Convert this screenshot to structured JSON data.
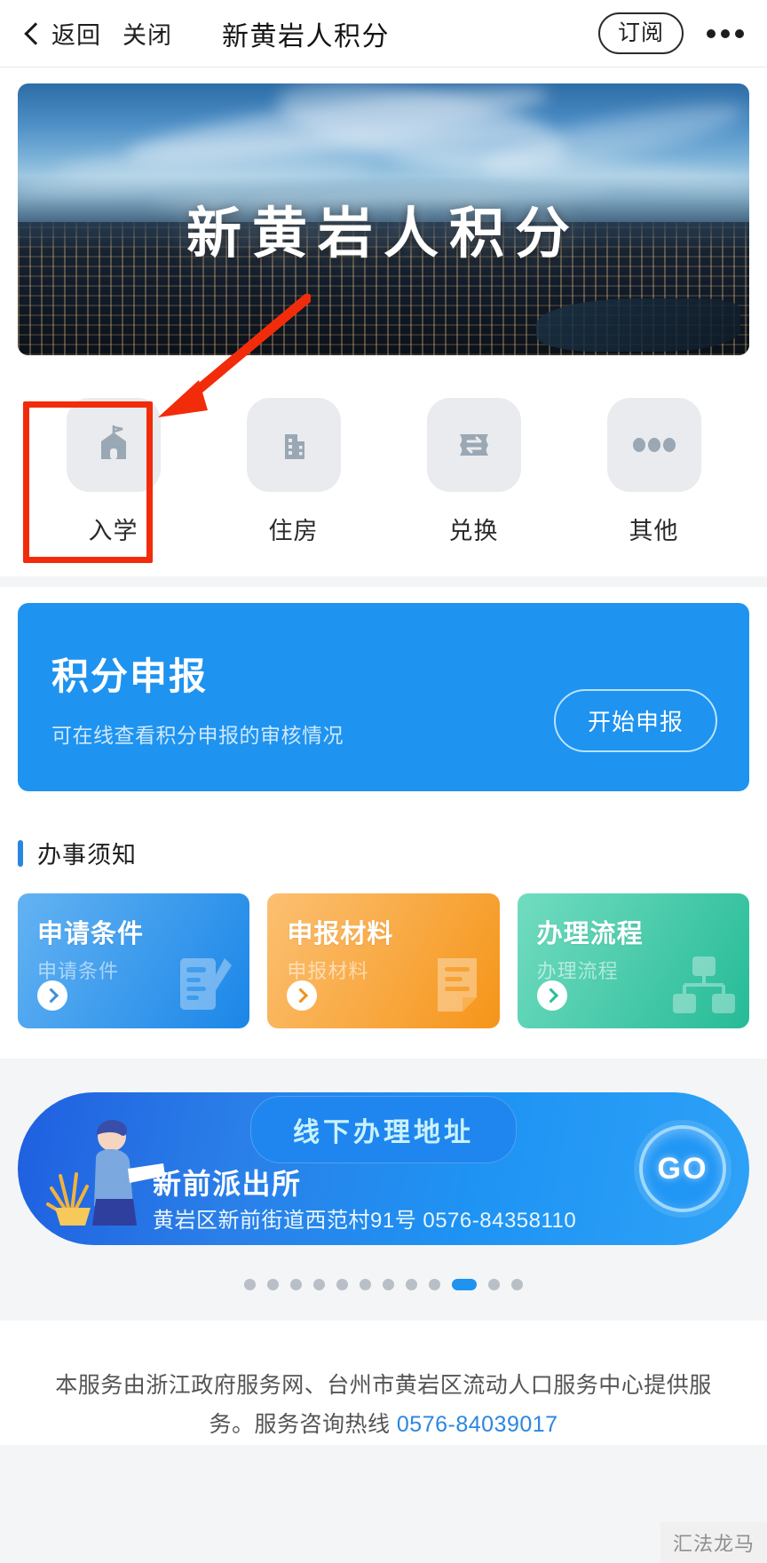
{
  "header": {
    "back_label": "返回",
    "close_label": "关闭",
    "title": "新黄岩人积分",
    "subscribe_label": "订阅",
    "more_icon": "more-dots-icon"
  },
  "banner": {
    "title": "新黄岩人积分",
    "image_description": "黄岩城市夜景航拍"
  },
  "categories": [
    {
      "label": "入学",
      "icon": "school-icon"
    },
    {
      "label": "住房",
      "icon": "building-icon"
    },
    {
      "label": "兑换",
      "icon": "ticket-exchange-icon"
    },
    {
      "label": "其他",
      "icon": "ellipsis-icon"
    }
  ],
  "declare": {
    "title": "积分申报",
    "subtitle": "可在线查看积分申报的审核情况",
    "button_label": "开始申报"
  },
  "notice": {
    "section_title": "办事须知",
    "cards": [
      {
        "title": "申请条件",
        "subtitle": "申请条件",
        "color": "#1b86e8",
        "icon": "document-pen-icon"
      },
      {
        "title": "申报材料",
        "subtitle": "申报材料",
        "color": "#f59519",
        "icon": "document-icon"
      },
      {
        "title": "办理流程",
        "subtitle": "办理流程",
        "color": "#26bb97",
        "icon": "flowchart-icon"
      }
    ]
  },
  "address": {
    "pill_label": "线下办理地址",
    "name": "新前派出所",
    "detail": "黄岩区新前街道西范村91号 0576-84358110",
    "go_label": "GO"
  },
  "carousel": {
    "total": 12,
    "active_index": 10
  },
  "footer": {
    "line1": "本服务由浙江政府服务网、台州市黄岩区流动人口服务中心提供服",
    "line2_prefix": "务。服务咨询热线 ",
    "phone": "0576-84039017"
  },
  "watermark": {
    "text": "汇法龙马"
  },
  "annotations": {
    "highlight_color": "#f22c0b",
    "highlight_target": "入学"
  }
}
